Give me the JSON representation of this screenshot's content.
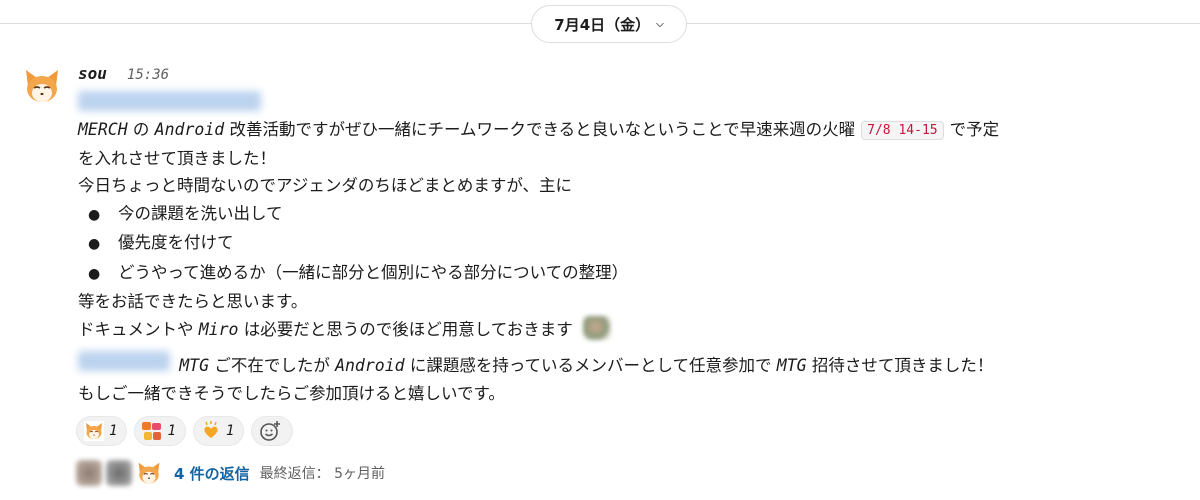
{
  "date_divider": {
    "label": "7月4日（金）",
    "chevron": "chevron-down-icon"
  },
  "message": {
    "author": "sou",
    "time": "15:36",
    "avatar_icon": "fox-avatar-icon",
    "seg_merch": "MERCH",
    "seg_no": "の",
    "seg_android": "Android",
    "seg_line1_rest": "改善活動ですがぜひ一緒にチームワークできると良いなということで早速来週の火曜",
    "code_date": "7/8 14-15",
    "seg_line1_end": "で予定",
    "line2": "を入れさせて頂きました！",
    "line3": "今日ちょっと時間ないのでアジェンダのちほどまとめますが、主に",
    "bullet_char": "●",
    "bullets": [
      "今の課題を洗い出して",
      "優先度を付けて",
      "どうやって進めるか（一緒に部分と個別にやる部分についての整理）"
    ],
    "line4": "等をお話できたらと思います。",
    "line5_a": "ドキュメントや",
    "line5_miro": "Miro",
    "line5_b": "は必要だと思うので後ほど用意しておきます",
    "para2_mtg1": "MTG",
    "para2_a": "ご不在でしたが",
    "para2_android": "Android",
    "para2_b": "に課題感を持っているメンバーとして任意参加で",
    "para2_mtg2": "MTG",
    "para2_c": "招待させて頂きました！",
    "para2_line2": "もしご一緒できそうでしたらご参加頂けると嬉しいです。"
  },
  "reactions": [
    {
      "icon": "fox-emoji-icon",
      "count": "1"
    },
    {
      "icon": "sugoi-emoji-icon",
      "count": "1"
    },
    {
      "icon": "heart-hands-emoji-icon",
      "count": "1"
    }
  ],
  "add_reaction_icon": "add-reaction-icon",
  "thread": {
    "replies_label": "4 件の返信",
    "last_reply_label": "最終返信：",
    "last_reply_time": "5ヶ月前"
  },
  "colors": {
    "link": "#1264a3",
    "code_text": "#c4163c",
    "mention_bg": "#bcd3ef"
  }
}
